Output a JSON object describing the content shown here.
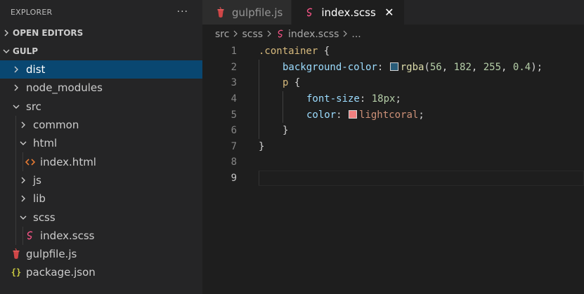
{
  "explorer": {
    "title": "EXPLORER",
    "more_label": "···",
    "open_editors_label": "OPEN EDITORS",
    "folder_label": "GULP",
    "tree": [
      {
        "label": "dist",
        "kind": "folder",
        "expanded": false,
        "depth": 0,
        "selected": true
      },
      {
        "label": "node_modules",
        "kind": "folder",
        "expanded": false,
        "depth": 0
      },
      {
        "label": "src",
        "kind": "folder",
        "expanded": true,
        "depth": 0
      },
      {
        "label": "common",
        "kind": "folder",
        "expanded": false,
        "depth": 1
      },
      {
        "label": "html",
        "kind": "folder",
        "expanded": true,
        "depth": 1
      },
      {
        "label": "index.html",
        "kind": "html-file",
        "depth": 2
      },
      {
        "label": "js",
        "kind": "folder",
        "expanded": false,
        "depth": 1
      },
      {
        "label": "lib",
        "kind": "folder",
        "expanded": false,
        "depth": 1
      },
      {
        "label": "scss",
        "kind": "folder",
        "expanded": true,
        "depth": 1
      },
      {
        "label": "index.scss",
        "kind": "scss-file",
        "depth": 2
      },
      {
        "label": "gulpfile.js",
        "kind": "gulp-file",
        "depth": 0
      },
      {
        "label": "package.json",
        "kind": "json-file",
        "depth": 0
      }
    ]
  },
  "tabs": [
    {
      "label": "gulpfile.js",
      "icon": "gulp-icon",
      "active": false
    },
    {
      "label": "index.scss",
      "icon": "scss-icon",
      "active": true,
      "close": "✕"
    }
  ],
  "breadcrumb": {
    "parts": [
      "src",
      "scss",
      "index.scss",
      "..."
    ]
  },
  "code": {
    "lines": [
      {
        "n": "1",
        "html": [
          [
            "t-sel",
            ".container"
          ],
          [
            "t-punc",
            " {"
          ]
        ],
        "indent": 0
      },
      {
        "n": "2",
        "indent": 1,
        "html": [
          [
            "t-prop",
            "background-color"
          ],
          [
            "t-punc",
            ": "
          ],
          [
            "swatch",
            "rgba(56,182,255,0.4)"
          ],
          [
            "t-fn",
            "rgba"
          ],
          [
            "t-punc",
            "("
          ],
          [
            "t-num",
            "56"
          ],
          [
            "t-punc",
            ", "
          ],
          [
            "t-num",
            "182"
          ],
          [
            "t-punc",
            ", "
          ],
          [
            "t-num",
            "255"
          ],
          [
            "t-punc",
            ", "
          ],
          [
            "t-num",
            "0.4"
          ],
          [
            "t-punc",
            ");"
          ]
        ]
      },
      {
        "n": "3",
        "indent": 1,
        "html": [
          [
            "t-sel",
            "p"
          ],
          [
            "t-punc",
            " {"
          ]
        ]
      },
      {
        "n": "4",
        "indent": 2,
        "html": [
          [
            "t-prop",
            "font-size"
          ],
          [
            "t-punc",
            ": "
          ],
          [
            "t-num",
            "18px"
          ],
          [
            "t-punc",
            ";"
          ]
        ]
      },
      {
        "n": "5",
        "indent": 2,
        "html": [
          [
            "t-prop",
            "color"
          ],
          [
            "t-punc",
            ": "
          ],
          [
            "swatch",
            "#f08080"
          ],
          [
            "t-val",
            "lightcoral"
          ],
          [
            "t-punc",
            ";"
          ]
        ]
      },
      {
        "n": "6",
        "indent": 1,
        "html": [
          [
            "t-punc",
            "}"
          ]
        ]
      },
      {
        "n": "7",
        "indent": 0,
        "html": [
          [
            "t-punc",
            "}"
          ]
        ]
      },
      {
        "n": "8",
        "indent": 0,
        "html": []
      },
      {
        "n": "9",
        "indent": 0,
        "html": [],
        "current": true
      }
    ]
  },
  "colors": {
    "selection": "#094771",
    "sidebar_bg": "#252526",
    "editor_bg": "#1e1e1e",
    "gulp_red": "#cf4647",
    "scss_pink": "#f55385",
    "html_orange": "#e37933",
    "json_yellow": "#cbcb41"
  }
}
